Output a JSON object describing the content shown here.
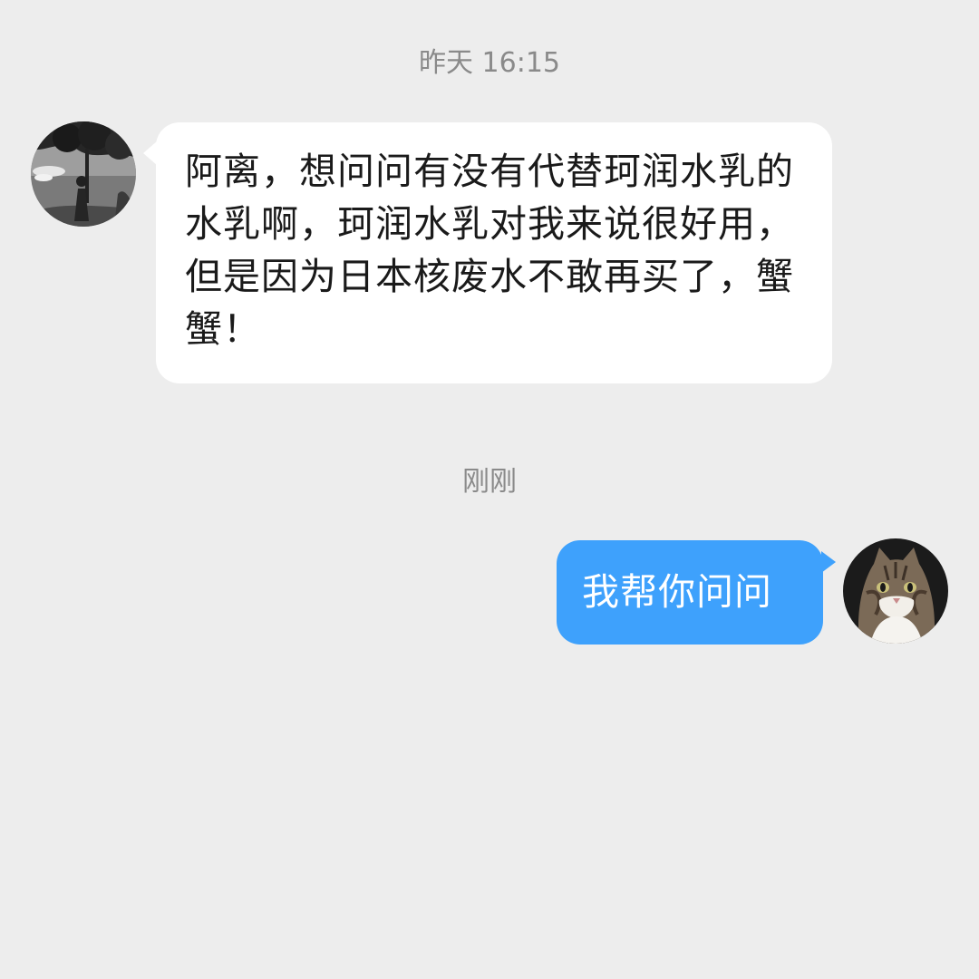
{
  "chat": {
    "timestamp_1": "昨天 16:15",
    "timestamp_2": "刚刚",
    "messages": [
      {
        "sender": "other",
        "avatar": "avatar-girl-under-tree",
        "text": "阿离，想问问有没有代替珂润水乳的水乳啊，珂润水乳对我来说很好用，但是因为日本核废水不敢再买了，蟹蟹！"
      },
      {
        "sender": "self",
        "avatar": "avatar-tabby-cat",
        "text": "我帮你问问"
      }
    ]
  },
  "colors": {
    "background": "#ededed",
    "incoming_bubble": "#ffffff",
    "outgoing_bubble": "#3ea1fc",
    "timestamp_text": "#8a8a8a"
  }
}
